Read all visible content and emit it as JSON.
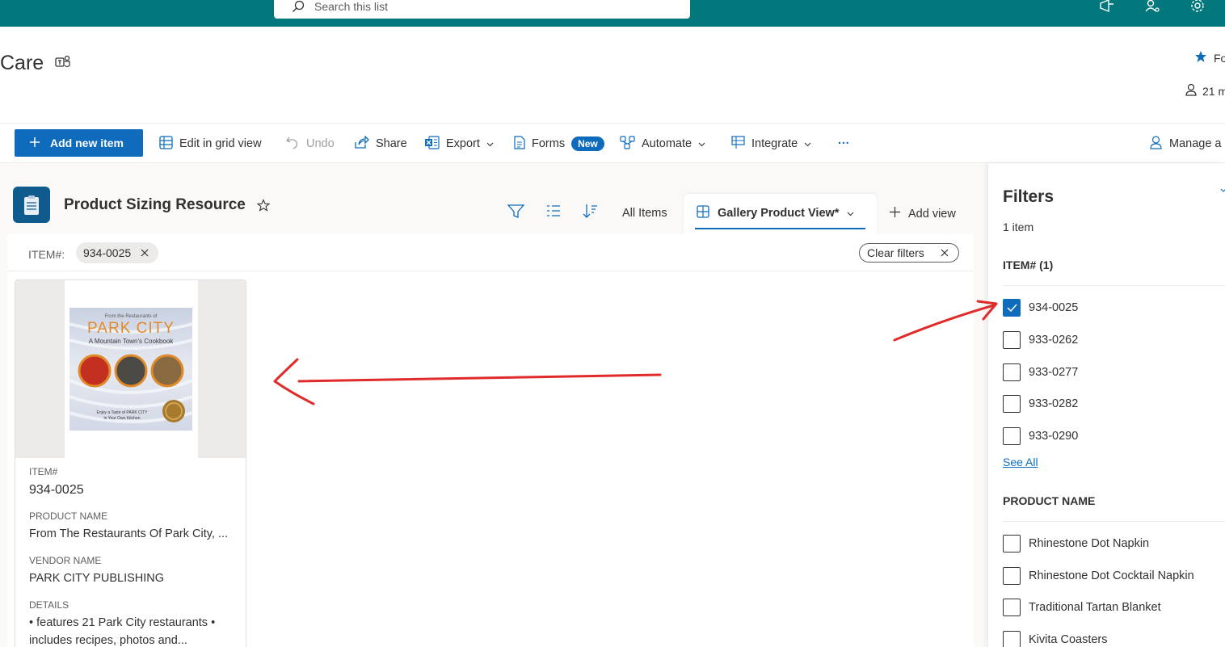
{
  "colors": {
    "suite_bar": "#03787c",
    "accent": "#0f6cbd",
    "annotation": "#e02b2b"
  },
  "search": {
    "placeholder": "Search this list"
  },
  "site": {
    "title": "Care",
    "follow_label": "Fo",
    "members_label": "21 m"
  },
  "commands": {
    "add_new_item": "Add new item",
    "edit_grid": "Edit in grid view",
    "undo": "Undo",
    "share": "Share",
    "export": "Export",
    "forms": "Forms",
    "forms_badge": "New",
    "automate": "Automate",
    "integrate": "Integrate",
    "more": "···",
    "manage_access": "Manage a"
  },
  "list": {
    "title": "Product Sizing Resource",
    "views": {
      "all_items": "All Items",
      "current": "Gallery Product View*",
      "add_view": "Add view"
    }
  },
  "active_filter": {
    "label": "ITEM#:",
    "value": "934-0025",
    "clear": "Clear filters"
  },
  "card": {
    "cover": {
      "line1": "From the Restaurants of",
      "line2": "PARK CITY",
      "line3": "A Mountain Town's Cookbook",
      "line4": "Enjoy a Taste of PARK CITY",
      "line5": "in Your Own Kitchen"
    },
    "fields": [
      {
        "label": "ITEM#",
        "value": "934-0025"
      },
      {
        "label": "PRODUCT NAME",
        "value": "From The Restaurants Of Park City, ..."
      },
      {
        "label": "VENDOR NAME",
        "value": "PARK CITY PUBLISHING"
      },
      {
        "label": "DETAILS",
        "value": "• features 21 Park City restaurants •",
        "value2": "includes recipes, photos and..."
      }
    ]
  },
  "filters_pane": {
    "title": "Filters",
    "count": "1 item",
    "item_section": "ITEM# (1)",
    "item_options": [
      {
        "label": "934-0025",
        "checked": true
      },
      {
        "label": "933-0262",
        "checked": false
      },
      {
        "label": "933-0277",
        "checked": false
      },
      {
        "label": "933-0282",
        "checked": false
      },
      {
        "label": "933-0290",
        "checked": false
      }
    ],
    "see_all": "See All",
    "product_section": "PRODUCT NAME",
    "product_options": [
      {
        "label": "Rhinestone Dot Napkin",
        "checked": false
      },
      {
        "label": "Rhinestone Dot Cocktail Napkin",
        "checked": false
      },
      {
        "label": "Traditional Tartan Blanket",
        "checked": false
      },
      {
        "label": "Kivita Coasters",
        "checked": false
      }
    ]
  }
}
